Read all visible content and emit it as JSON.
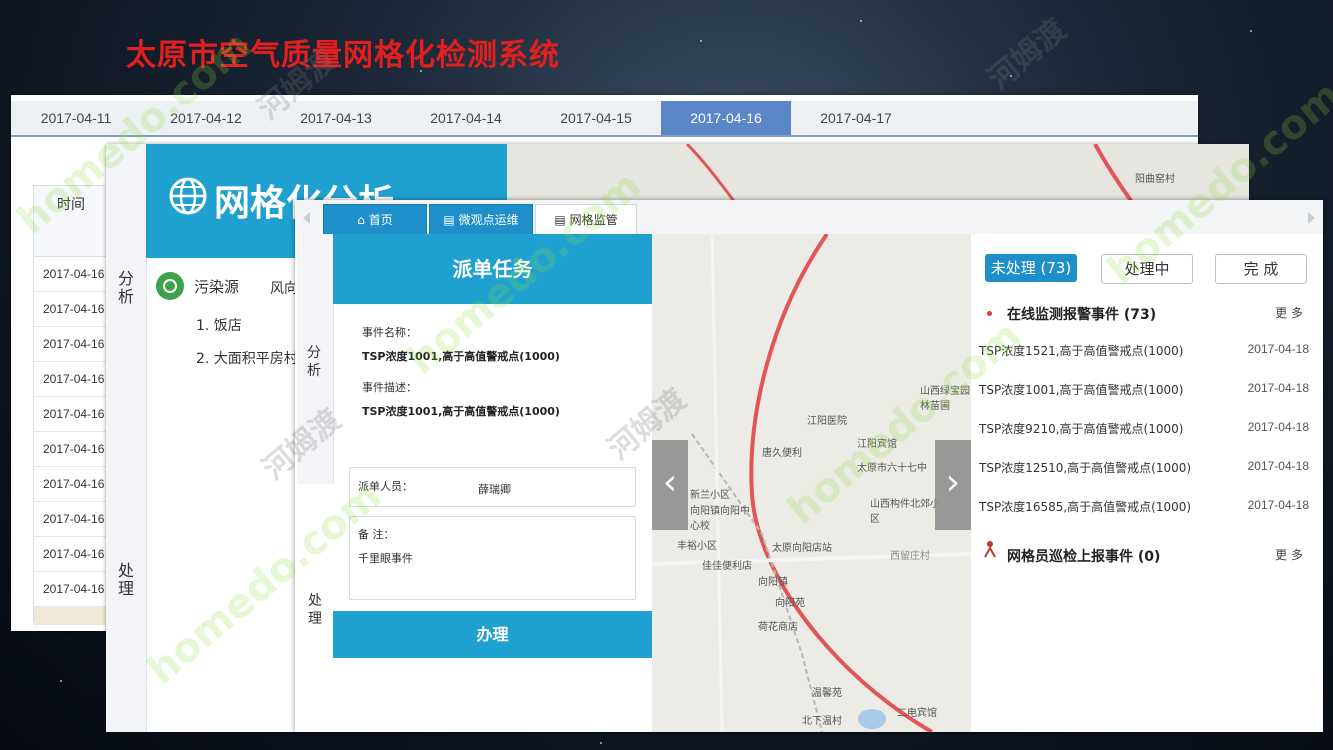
{
  "slide": {
    "title": "太原市空气质量网格化检测系统"
  },
  "date_tabs": [
    "2017-04-11",
    "2017-04-12",
    "2017-04-13",
    "2017-04-14",
    "2017-04-15",
    "2017-04-16",
    "2017-04-17"
  ],
  "date_tabs_active_index": 5,
  "time_table": {
    "header": "时间",
    "rows": [
      "2017-04-16",
      "2017-04-16",
      "2017-04-16",
      "2017-04-16",
      "2017-04-16",
      "2017-04-16",
      "2017-04-16",
      "2017-04-16",
      "2017-04-16",
      "2017-04-16"
    ]
  },
  "grid_analysis": {
    "sidebar_analyze": "分析",
    "sidebar_handle": "处理",
    "banner_title": "网格化分析",
    "pollution_label": "污染源",
    "wind_label": "风向",
    "sources": [
      "1.  饭店",
      "2.  大面积平房村"
    ]
  },
  "dispatch": {
    "tabs": [
      "首页",
      "微观点运维",
      "网格监管"
    ],
    "sidebar_analyze": "分析",
    "sidebar_handle": "处理",
    "header": "派单任务",
    "event_name_label": "事件名称：",
    "event_name_value": "TSP浓度1001,高于高值警戒点(1000)",
    "event_desc_label": "事件描述：",
    "event_desc_value": "TSP浓度1001,高于高值警戒点(1000)",
    "dispatcher_label": "派单人员：",
    "dispatcher_value": "薛瑞卿",
    "remark_label": "备 注：",
    "remark_value": "千里眼事件",
    "submit_label": "办理"
  },
  "map_labels": [
    "江阳医院",
    "唐久便利",
    "江阳宾馆",
    "太原市六十七中",
    "新兰小区",
    "向阳镇向阳中心校",
    "丰裕小区",
    "佳佳便利店",
    "太原向阳店站",
    "向阳镇",
    "向阳苑",
    "荷花商店",
    "西留庄村",
    "山西构件北郊小区",
    "山西绿宝园林苗圃",
    "温馨苑",
    "北下温村",
    "二电宾馆",
    "阳曲窑村"
  ],
  "status": {
    "unprocessed": "未处理 (73)",
    "processing": "处理中",
    "done": "完 成"
  },
  "online_events": {
    "title": "在线监测报警事件 (73)",
    "more": "更 多",
    "items": [
      {
        "text": "TSP浓度1521,高于高值警戒点(1000)",
        "date": "2017-04-18"
      },
      {
        "text": "TSP浓度1001,高于高值警戒点(1000)",
        "date": "2017-04-18"
      },
      {
        "text": "TSP浓度9210,高于高值警戒点(1000)",
        "date": "2017-04-18"
      },
      {
        "text": "TSP浓度12510,高于高值警戒点(1000)",
        "date": "2017-04-18"
      },
      {
        "text": "TSP浓度16585,高于高值警戒点(1000)",
        "date": "2017-04-18"
      }
    ]
  },
  "grid_events": {
    "title": "网格员巡检上报事件 (0)",
    "more": "更 多"
  },
  "watermark": {
    "brand": "homedo.com",
    "cn": "河姆渡"
  },
  "colors": {
    "title_red": "#e01f1f",
    "accent_blue": "#1ea1cf",
    "tab_blue": "#5b86c7"
  }
}
